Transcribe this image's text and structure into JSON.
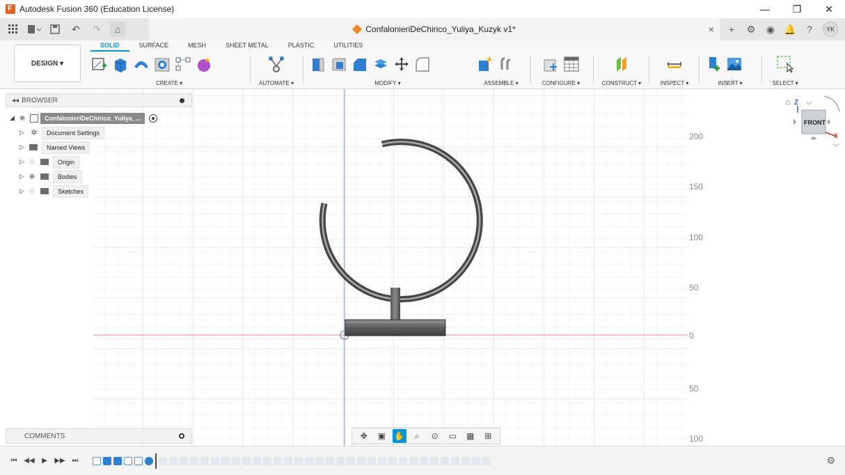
{
  "window": {
    "title": "Autodesk Fusion 360 (Education License)",
    "controls": [
      "—",
      "❐",
      "✕"
    ]
  },
  "document": {
    "tab_title": "ConfalonieriDeChirico_Yuliya_Kuzyk v1*"
  },
  "user": {
    "initials": "YK"
  },
  "ribbon": {
    "workspace": "DESIGN ▾",
    "tabs": [
      "SOLID",
      "SURFACE",
      "MESH",
      "SHEET METAL",
      "PLASTIC",
      "UTILITIES"
    ],
    "active_tab": "SOLID",
    "groups": {
      "create": "CREATE ▾",
      "automate": "AUTOMATE ▾",
      "modify": "MODIFY ▾",
      "assemble": "ASSEMBLE ▾",
      "configure": "CONFIGURE ▾",
      "construct": "CONSTRUCT ▾",
      "inspect": "INSPECT ▾",
      "insert": "INSERT ▾",
      "select": "SELECT ▾"
    }
  },
  "browser": {
    "title": "BROWSER",
    "root": "ConfalonieriDeChirico_Yuliya_...",
    "items": [
      {
        "label": "Document Settings",
        "icon": "gear-icon"
      },
      {
        "label": "Named Views",
        "icon": "folder-icon"
      },
      {
        "label": "Origin",
        "icon": "folder-icon"
      },
      {
        "label": "Bodies",
        "icon": "folder-icon"
      },
      {
        "label": "Sketches",
        "icon": "folder-icon"
      }
    ]
  },
  "comments": {
    "title": "COMMENTS"
  },
  "viewcube": {
    "face": "FRONT",
    "axis_z": "Z",
    "axis_x": "X"
  },
  "ruler": {
    "labels": [
      "200",
      "150",
      "100",
      "50",
      "0",
      "50",
      "100"
    ]
  },
  "colors": {
    "accent": "#0696d7",
    "grid": "#d9dde2",
    "x_axis": "#e08a8a",
    "y_axis": "#7f96b5",
    "model": "#5a5a5a"
  }
}
